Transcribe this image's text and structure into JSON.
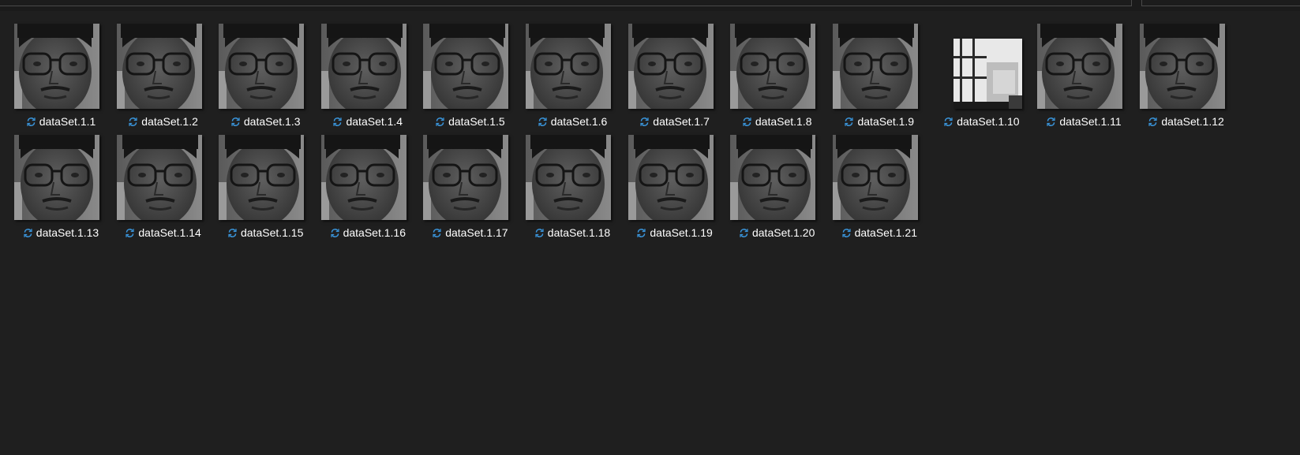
{
  "files": [
    {
      "name": "dataSet.1.1",
      "variant": "face"
    },
    {
      "name": "dataSet.1.2",
      "variant": "face"
    },
    {
      "name": "dataSet.1.3",
      "variant": "face"
    },
    {
      "name": "dataSet.1.4",
      "variant": "face"
    },
    {
      "name": "dataSet.1.5",
      "variant": "face"
    },
    {
      "name": "dataSet.1.6",
      "variant": "face"
    },
    {
      "name": "dataSet.1.7",
      "variant": "face"
    },
    {
      "name": "dataSet.1.8",
      "variant": "face"
    },
    {
      "name": "dataSet.1.9",
      "variant": "face"
    },
    {
      "name": "dataSet.1.10",
      "variant": "window"
    },
    {
      "name": "dataSet.1.11",
      "variant": "face"
    },
    {
      "name": "dataSet.1.12",
      "variant": "face"
    },
    {
      "name": "dataSet.1.13",
      "variant": "face"
    },
    {
      "name": "dataSet.1.14",
      "variant": "face"
    },
    {
      "name": "dataSet.1.15",
      "variant": "face"
    },
    {
      "name": "dataSet.1.16",
      "variant": "face"
    },
    {
      "name": "dataSet.1.17",
      "variant": "face"
    },
    {
      "name": "dataSet.1.18",
      "variant": "face"
    },
    {
      "name": "dataSet.1.19",
      "variant": "face"
    },
    {
      "name": "dataSet.1.20",
      "variant": "face"
    },
    {
      "name": "dataSet.1.21",
      "variant": "face"
    }
  ],
  "status_icon": "sync-pending-icon",
  "colors": {
    "background": "#1f1f1f",
    "label_text": "#ffffff",
    "sync_icon": "#3a96dd"
  }
}
